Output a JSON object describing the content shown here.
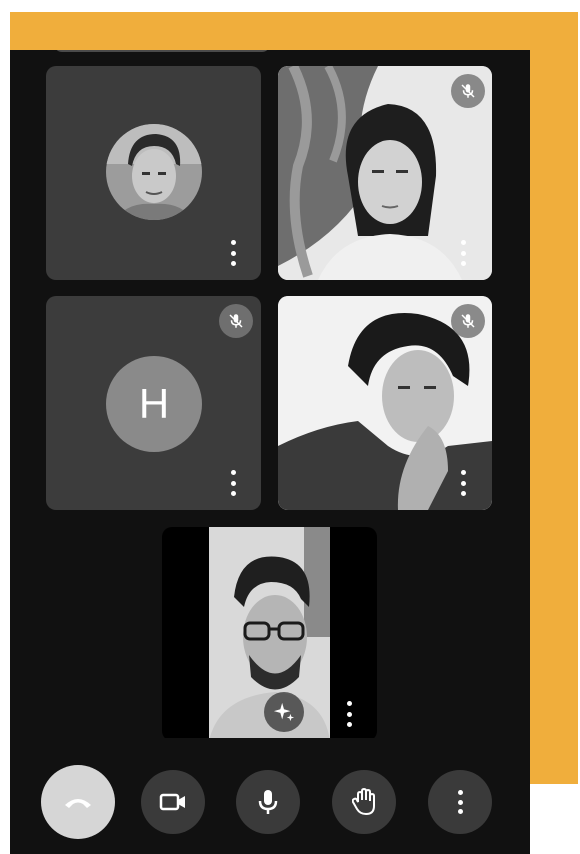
{
  "app": {
    "accent_color": "#F0AE3C",
    "surface_color": "#111111",
    "tile_color": "#3c3c3c"
  },
  "participants": [
    {
      "kind": "avatar-photo",
      "muted": false,
      "icons": [
        "more-options-icon"
      ]
    },
    {
      "kind": "video",
      "muted": true,
      "icons": [
        "mic-off-icon",
        "more-options-icon"
      ]
    },
    {
      "kind": "avatar-letter",
      "initial": "H",
      "muted": true,
      "icons": [
        "mic-off-icon",
        "more-options-icon"
      ]
    },
    {
      "kind": "video",
      "muted": true,
      "icons": [
        "mic-off-icon",
        "more-options-icon"
      ]
    },
    {
      "kind": "self-video",
      "muted": false,
      "icons": [
        "effects-sparkle-icon",
        "more-options-icon"
      ]
    }
  ],
  "controls": [
    {
      "name": "end-call",
      "icon": "phone-hangup-icon"
    },
    {
      "name": "camera",
      "icon": "video-camera-icon"
    },
    {
      "name": "microphone",
      "icon": "microphone-icon"
    },
    {
      "name": "raise-hand",
      "icon": "hand-icon"
    },
    {
      "name": "more",
      "icon": "more-vertical-icon"
    }
  ]
}
